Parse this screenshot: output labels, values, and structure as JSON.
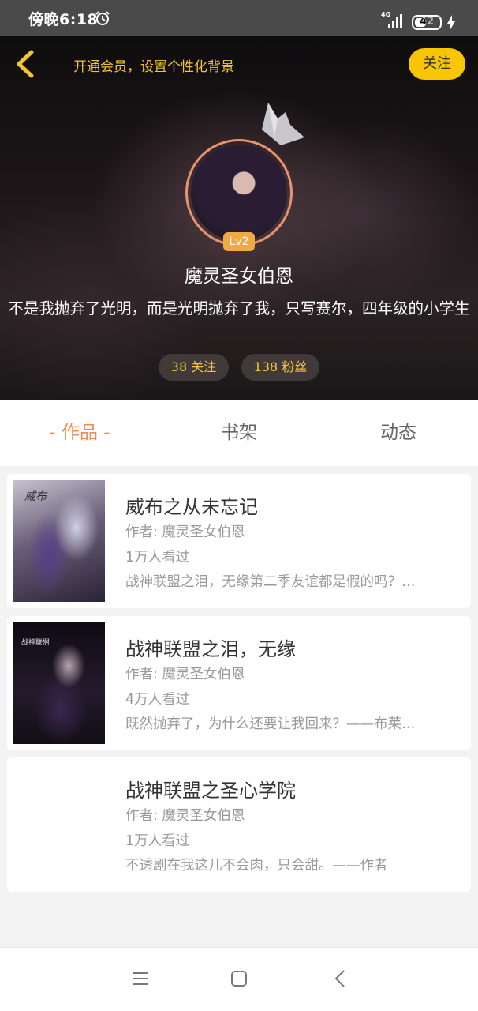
{
  "status_bar": {
    "time": "傍晚6:18",
    "network": "4G",
    "battery": "42"
  },
  "header": {
    "vip_tip": "开通会员，设置个性化背景",
    "follow_label": "关注",
    "level": "Lv2",
    "user_name": "魔灵圣女伯恩",
    "bio": "不是我抛弃了光明，而是光明抛弃了我，只写赛尔，四年级的小学生",
    "following": "38 关注",
    "fans": "138 粉丝",
    "accent_color": "#f3c437"
  },
  "tabs": [
    {
      "label": "- 作品 -",
      "active": true
    },
    {
      "label": "书架",
      "active": false
    },
    {
      "label": "动态",
      "active": false
    }
  ],
  "books": [
    {
      "title": "威布之从未忘记",
      "author": "作者: 魔灵圣女伯恩",
      "views": "1万人看过",
      "desc": "战神联盟之泪，无缘第二季友谊都是假的吗？…",
      "cover_caption": "威布"
    },
    {
      "title": "战神联盟之泪，无缘",
      "author": "作者: 魔灵圣女伯恩",
      "views": "4万人看过",
      "desc": "既然抛弃了，为什么还要让我回来？——布莱…",
      "cover_caption": "战神联盟"
    },
    {
      "title": "战神联盟之圣心学院",
      "author": "作者: 魔灵圣女伯恩",
      "views": "1万人看过",
      "desc": "不透剧在我这儿不会肉，只会甜。——作者",
      "cover_caption": ""
    }
  ],
  "nav": {
    "icons": [
      "menu-icon",
      "home-icon",
      "back-icon"
    ]
  }
}
